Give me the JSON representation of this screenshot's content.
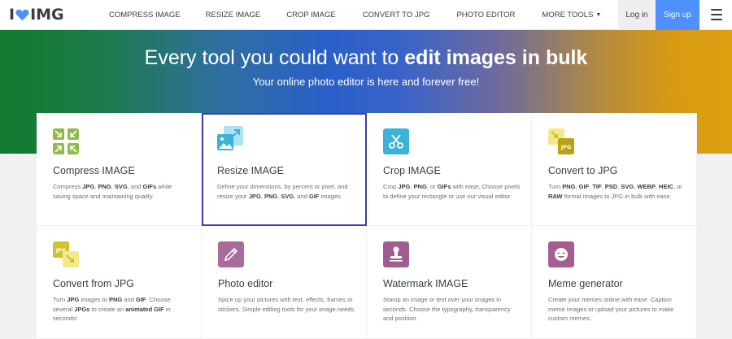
{
  "header": {
    "logo_i": "I",
    "logo_img": "IMG",
    "nav": [
      {
        "label": "COMPRESS IMAGE"
      },
      {
        "label": "RESIZE IMAGE"
      },
      {
        "label": "CROP IMAGE"
      },
      {
        "label": "CONVERT TO JPG"
      },
      {
        "label": "PHOTO EDITOR"
      },
      {
        "label": "MORE TOOLS"
      }
    ],
    "login": "Log in",
    "signup": "Sign up"
  },
  "hero": {
    "title_pre": "Every tool you could want to ",
    "title_bold": "edit images in bulk",
    "subtitle": "Your online photo editor is here and forever free!"
  },
  "tools": [
    {
      "title": "Compress IMAGE",
      "desc_html": "Compress <b>JPG</b>, <b>PNG</b>, <b>SVG</b>, and <b>GIFs</b> while saving space and maintaining quality.",
      "icon": "compress-icon",
      "color": "#8fbc48"
    },
    {
      "title": "Resize IMAGE",
      "desc_html": "Define your dimensions, by percent or pixel, and resize your <b>JPG</b>, <b>PNG</b>, <b>SVG</b>, and <b>GIF</b> images.",
      "icon": "resize-icon",
      "color": "#5bc0de"
    },
    {
      "title": "Crop IMAGE",
      "desc_html": "Crop <b>JPG</b>, <b>PNG</b>, or <b>GIFs</b> with ease; Choose pixels to define your rectangle or use our visual editor.",
      "icon": "crop-icon",
      "color": "#3cb2d6"
    },
    {
      "title": "Convert to JPG",
      "desc_html": "Turn <b>PNG</b>, <b>GIF</b>, <b>TIF</b>, <b>PSD</b>, <b>SVG</b>, <b>WEBP</b>, <b>HEIC</b>, or <b>RAW</b> format images to JPG in bulk with ease.",
      "icon": "convert-to-jpg-icon",
      "color": "#c9b31e",
      "badge": "JPG"
    },
    {
      "title": "Convert from JPG",
      "desc_html": "Turn <b>JPG</b> images to <b>PNG</b> and <b>GIF</b>. Choose several <b>JPGs</b> to create an <b>animated GIF</b> in seconds!",
      "icon": "convert-from-jpg-icon",
      "color": "#d4c22a",
      "badge": "JPG"
    },
    {
      "title": "Photo editor",
      "desc_html": "Spice up your pictures with text, effects, frames or stickers. Simple editing tools for your image needs.",
      "icon": "pencil-icon",
      "color": "#a86b9b"
    },
    {
      "title": "Watermark IMAGE",
      "desc_html": "Stamp an image or text over your images in seconds. Choose the typography, transparency and position.",
      "icon": "stamp-icon",
      "color": "#a25d90"
    },
    {
      "title": "Meme generator",
      "desc_html": "Create your memes online with ease. Caption meme images or upload your pictures to make custom memes.",
      "icon": "smiley-icon",
      "color": "#a45e92"
    }
  ]
}
